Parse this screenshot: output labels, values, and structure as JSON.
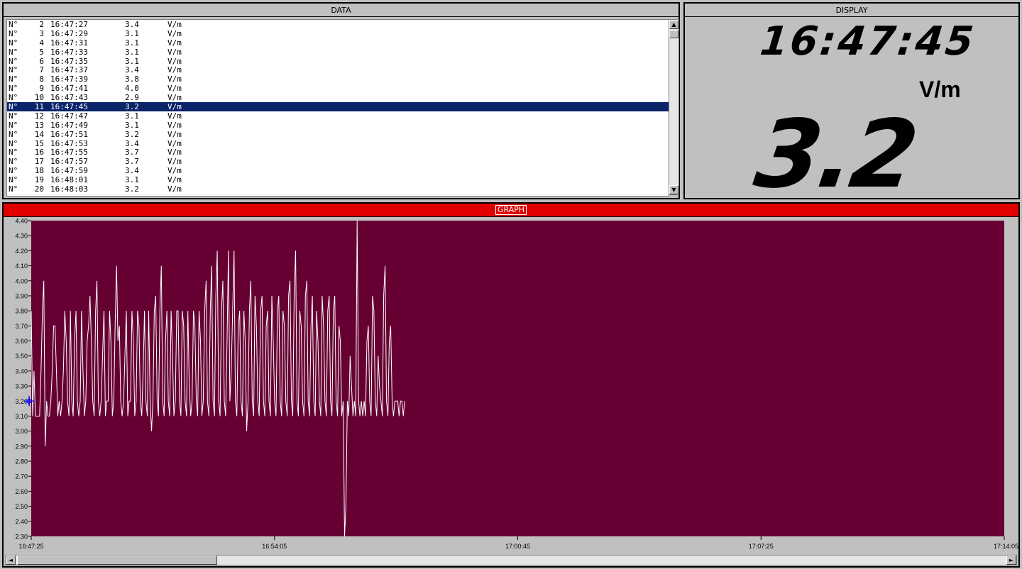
{
  "data_panel": {
    "title": "DATA",
    "selected_row": 9,
    "rows": [
      {
        "prefix": "N°",
        "index": "2",
        "time": "16:47:27",
        "value": "3.4",
        "unit": "V/m"
      },
      {
        "prefix": "N°",
        "index": "3",
        "time": "16:47:29",
        "value": "3.1",
        "unit": "V/m"
      },
      {
        "prefix": "N°",
        "index": "4",
        "time": "16:47:31",
        "value": "3.1",
        "unit": "V/m"
      },
      {
        "prefix": "N°",
        "index": "5",
        "time": "16:47:33",
        "value": "3.1",
        "unit": "V/m"
      },
      {
        "prefix": "N°",
        "index": "6",
        "time": "16:47:35",
        "value": "3.1",
        "unit": "V/m"
      },
      {
        "prefix": "N°",
        "index": "7",
        "time": "16:47:37",
        "value": "3.4",
        "unit": "V/m"
      },
      {
        "prefix": "N°",
        "index": "8",
        "time": "16:47:39",
        "value": "3.8",
        "unit": "V/m"
      },
      {
        "prefix": "N°",
        "index": "9",
        "time": "16:47:41",
        "value": "4.0",
        "unit": "V/m"
      },
      {
        "prefix": "N°",
        "index": "10",
        "time": "16:47:43",
        "value": "2.9",
        "unit": "V/m"
      },
      {
        "prefix": "N°",
        "index": "11",
        "time": "16:47:45",
        "value": "3.2",
        "unit": "V/m"
      },
      {
        "prefix": "N°",
        "index": "12",
        "time": "16:47:47",
        "value": "3.1",
        "unit": "V/m"
      },
      {
        "prefix": "N°",
        "index": "13",
        "time": "16:47:49",
        "value": "3.1",
        "unit": "V/m"
      },
      {
        "prefix": "N°",
        "index": "14",
        "time": "16:47:51",
        "value": "3.2",
        "unit": "V/m"
      },
      {
        "prefix": "N°",
        "index": "15",
        "time": "16:47:53",
        "value": "3.4",
        "unit": "V/m"
      },
      {
        "prefix": "N°",
        "index": "16",
        "time": "16:47:55",
        "value": "3.7",
        "unit": "V/m"
      },
      {
        "prefix": "N°",
        "index": "17",
        "time": "16:47:57",
        "value": "3.7",
        "unit": "V/m"
      },
      {
        "prefix": "N°",
        "index": "18",
        "time": "16:47:59",
        "value": "3.4",
        "unit": "V/m"
      },
      {
        "prefix": "N°",
        "index": "19",
        "time": "16:48:01",
        "value": "3.1",
        "unit": "V/m"
      },
      {
        "prefix": "N°",
        "index": "20",
        "time": "16:48:03",
        "value": "3.2",
        "unit": "V/m"
      }
    ]
  },
  "display_panel": {
    "title": "DISPLAY",
    "time": "16:47:45",
    "unit": "V/m",
    "value": "3.2"
  },
  "graph_panel": {
    "title": "GRAPH"
  },
  "colors": {
    "plot_bg": "#660033",
    "line": "#ffffff",
    "title_red": "#e00000",
    "selection": "#0a246a",
    "cursor": "#0000ff"
  },
  "icons": {
    "scroll_up": "scroll-up-icon",
    "scroll_down": "scroll-down-icon",
    "scroll_left": "scroll-left-icon",
    "scroll_right": "scroll-right-icon",
    "cursor": "crosshair-icon"
  },
  "chart_data": {
    "type": "line",
    "title": "",
    "xlabel": "",
    "ylabel": "",
    "ylim": [
      2.3,
      4.4
    ],
    "xlim": [
      "16:47:25",
      "17:14:05"
    ],
    "yticks": [
      "4.40",
      "4.30",
      "4.20",
      "4.10",
      "4.00",
      "3.90",
      "3.80",
      "3.70",
      "3.60",
      "3.50",
      "3.40",
      "3.30",
      "3.20",
      "3.10",
      "3.00",
      "2.90",
      "2.80",
      "2.70",
      "2.60",
      "2.50",
      "2.40",
      "2.30"
    ],
    "xticks": [
      "16:47:25",
      "16:54:05",
      "17:00:45",
      "17:07:25",
      "17:14:05"
    ],
    "grid": false,
    "x_start": "16:47:25",
    "x_step": "2 s",
    "cursor": {
      "x": "16:47:45",
      "y": 3.2
    },
    "series": [
      {
        "values": [
          3.8,
          3.1,
          3.4,
          3.1,
          3.1,
          3.1,
          3.1,
          3.4,
          3.8,
          4.0,
          2.9,
          3.2,
          3.1,
          3.1,
          3.2,
          3.4,
          3.7,
          3.7,
          3.4,
          3.1,
          3.2,
          3.1,
          3.2,
          3.4,
          3.8,
          3.6,
          3.2,
          3.1,
          3.8,
          3.2,
          3.1,
          3.6,
          3.8,
          3.2,
          3.1,
          3.2,
          3.8,
          3.4,
          3.1,
          3.2,
          3.6,
          3.7,
          3.9,
          3.6,
          3.2,
          3.1,
          3.8,
          4.0,
          3.2,
          3.1,
          3.2,
          3.5,
          3.8,
          3.1,
          3.2,
          3.2,
          3.8,
          3.6,
          3.1,
          3.2,
          3.7,
          4.1,
          3.6,
          3.7,
          3.2,
          3.1,
          3.2,
          3.5,
          3.8,
          3.1,
          3.2,
          3.2,
          3.8,
          3.6,
          3.1,
          3.2,
          3.8,
          3.7,
          3.2,
          3.1,
          3.4,
          3.8,
          3.2,
          3.1,
          3.8,
          3.2,
          3.0,
          3.2,
          3.8,
          3.9,
          3.2,
          3.1,
          3.8,
          4.1,
          3.2,
          3.1,
          3.6,
          3.8,
          3.2,
          3.1,
          3.8,
          3.5,
          3.1,
          3.2,
          3.8,
          3.8,
          3.2,
          3.1,
          3.8,
          3.7,
          3.2,
          3.1,
          3.8,
          3.3,
          3.1,
          3.2,
          3.8,
          3.7,
          3.2,
          3.1,
          3.8,
          3.6,
          3.1,
          3.2,
          3.8,
          4.0,
          3.2,
          3.1,
          3.8,
          4.1,
          3.2,
          3.1,
          3.9,
          4.2,
          3.2,
          3.1,
          3.8,
          4.0,
          3.2,
          3.1,
          3.6,
          4.2,
          3.2,
          3.4,
          3.8,
          4.2,
          3.2,
          3.1,
          3.7,
          3.8,
          3.2,
          3.1,
          3.8,
          3.6,
          3.0,
          3.2,
          3.8,
          4.0,
          3.2,
          3.1,
          3.9,
          3.7,
          3.2,
          3.1,
          3.8,
          3.9,
          3.2,
          3.1,
          3.7,
          3.8,
          3.2,
          3.1,
          3.9,
          3.6,
          3.2,
          3.1,
          3.8,
          3.9,
          3.2,
          3.1,
          3.8,
          3.7,
          3.2,
          3.1,
          3.9,
          4.0,
          3.2,
          3.1,
          3.9,
          4.2,
          3.2,
          3.1,
          3.8,
          3.7,
          3.2,
          3.1,
          3.9,
          4.0,
          3.2,
          3.1,
          3.7,
          3.9,
          3.2,
          3.1,
          3.8,
          3.6,
          3.2,
          3.1,
          3.9,
          3.7,
          3.2,
          3.1,
          3.8,
          3.9,
          3.2,
          3.1,
          3.8,
          3.9,
          3.2,
          3.1,
          3.7,
          3.6,
          3.1,
          3.2,
          2.3,
          2.5,
          3.2,
          3.1,
          3.5,
          3.3,
          3.1,
          3.2,
          3.1,
          4.4,
          3.2,
          3.1,
          3.2,
          3.1,
          3.2,
          3.1,
          3.6,
          3.7,
          3.2,
          3.1,
          3.9,
          3.8,
          3.2,
          3.1,
          3.5,
          3.3,
          3.2,
          3.1,
          3.9,
          4.1,
          3.2,
          3.1,
          3.6,
          3.7,
          3.2,
          3.1,
          3.2,
          3.2,
          3.2,
          3.1,
          3.2,
          3.2,
          3.1,
          3.2
        ]
      }
    ]
  }
}
